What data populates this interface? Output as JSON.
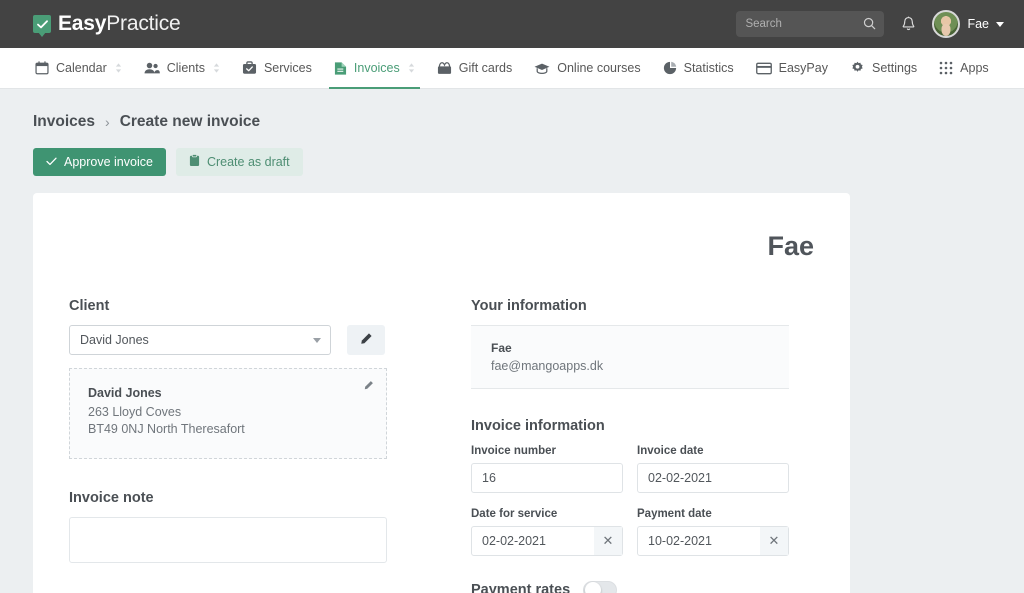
{
  "header": {
    "logo_bold": "Easy",
    "logo_light": "Practice",
    "logo_icon": "check-badge-icon",
    "search": {
      "placeholder": "Search",
      "value": "",
      "icon": "search-icon"
    },
    "notifications_icon": "bell-icon",
    "user": {
      "name": "Fae",
      "avatar": "user-avatar",
      "caret": "chevron-down-icon"
    },
    "bg_color": "#434343"
  },
  "nav": {
    "items": [
      {
        "label": "Calendar",
        "icon": "calendar-icon",
        "active": false,
        "has_chevrons": true
      },
      {
        "label": "Clients",
        "icon": "people-icon",
        "active": false,
        "has_chevrons": true
      },
      {
        "label": "Services",
        "icon": "briefcase-check-icon",
        "active": false,
        "has_chevrons": false
      },
      {
        "label": "Invoices",
        "icon": "document-icon",
        "active": true,
        "has_chevrons": true
      },
      {
        "label": "Gift cards",
        "icon": "gift-card-icon",
        "active": false,
        "has_chevrons": false
      },
      {
        "label": "Online courses",
        "icon": "graduation-cap-icon",
        "active": false,
        "has_chevrons": false
      },
      {
        "label": "Statistics",
        "icon": "pie-chart-icon",
        "active": false,
        "has_chevrons": false
      },
      {
        "label": "EasyPay",
        "icon": "credit-card-icon",
        "active": false,
        "has_chevrons": false
      },
      {
        "label": "Settings",
        "icon": "gear-icon",
        "active": false,
        "has_chevrons": false
      },
      {
        "label": "Apps",
        "icon": "grid-apps-icon",
        "active": false,
        "has_chevrons": false
      }
    ],
    "active_color": "#4a9d77"
  },
  "breadcrumb": {
    "parent": "Invoices",
    "separator": "›",
    "current": "Create new invoice"
  },
  "actions": {
    "approve_label": "Approve invoice",
    "approve_icon": "check-icon",
    "approve_color": "#3f9472",
    "draft_label": "Create as draft",
    "draft_icon": "clipboard-icon",
    "draft_color": "#dfece7"
  },
  "invoice": {
    "doc_title": "Fae",
    "client": {
      "section_title": "Client",
      "selected": "David Jones",
      "edit_icon": "pencil-icon",
      "address_edit_icon": "pencil-icon",
      "address": {
        "name": "David Jones",
        "line1": "263 Lloyd Coves",
        "line2": "BT49 0NJ North Theresafort"
      }
    },
    "note": {
      "title": "Invoice note",
      "value": "",
      "placeholder": ""
    },
    "your_information": {
      "title": "Your information",
      "name": "Fae",
      "email": "fae@mangoapps.dk"
    },
    "invoice_information": {
      "title": "Invoice information",
      "fields": [
        {
          "label": "Invoice number",
          "value": "16",
          "clearable": false
        },
        {
          "label": "Invoice date",
          "value": "02-02-2021",
          "clearable": false
        },
        {
          "label": "Date for service",
          "value": "02-02-2021",
          "clearable": true,
          "clear_icon": "close-icon"
        },
        {
          "label": "Payment date",
          "value": "10-02-2021",
          "clearable": true,
          "clear_icon": "close-icon"
        }
      ]
    },
    "payment_rates": {
      "label": "Payment rates",
      "enabled": false
    }
  }
}
